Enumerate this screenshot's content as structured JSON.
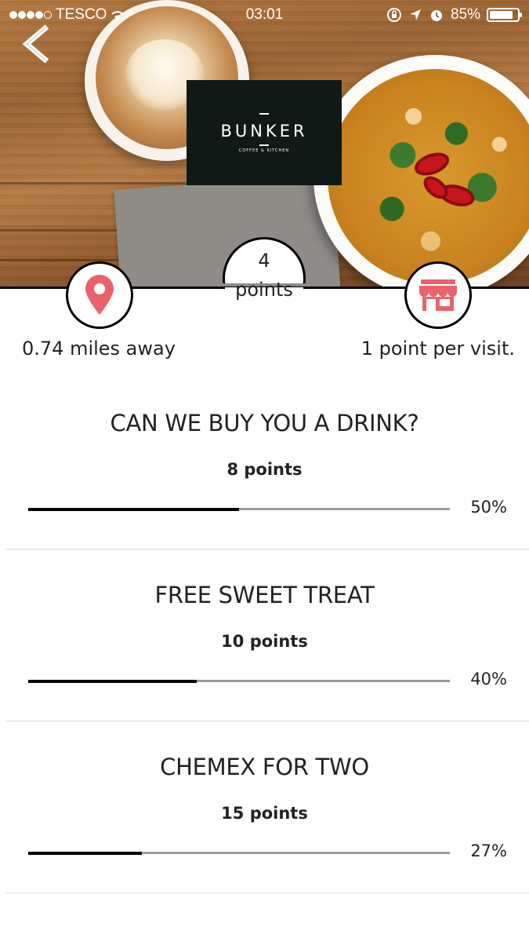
{
  "status_bar": {
    "carrier": "TESCO",
    "time": "03:01",
    "battery": "85%",
    "battery_level": 0.85,
    "signal_bars": 4
  },
  "venue": {
    "logo_name": "BUNKER",
    "logo_subtitle": "COFFEE & KITCHEN",
    "points": "4",
    "points_label": "points",
    "distance": "0.74 miles away",
    "rate": "1 point per visit."
  },
  "icons": {
    "back": "chevron-left-icon",
    "location": "map-pin-icon",
    "store": "store-icon",
    "accent_color": "#e8646a"
  },
  "rewards": [
    {
      "title": "CAN WE BUY YOU A DRINK?",
      "points": "8 points",
      "percent": "50%",
      "progress": 0.5
    },
    {
      "title": "FREE SWEET TREAT",
      "points": "10 points",
      "percent": "40%",
      "progress": 0.4
    },
    {
      "title": "CHEMEX FOR TWO",
      "points": "15 points",
      "percent": "27%",
      "progress": 0.27
    }
  ]
}
